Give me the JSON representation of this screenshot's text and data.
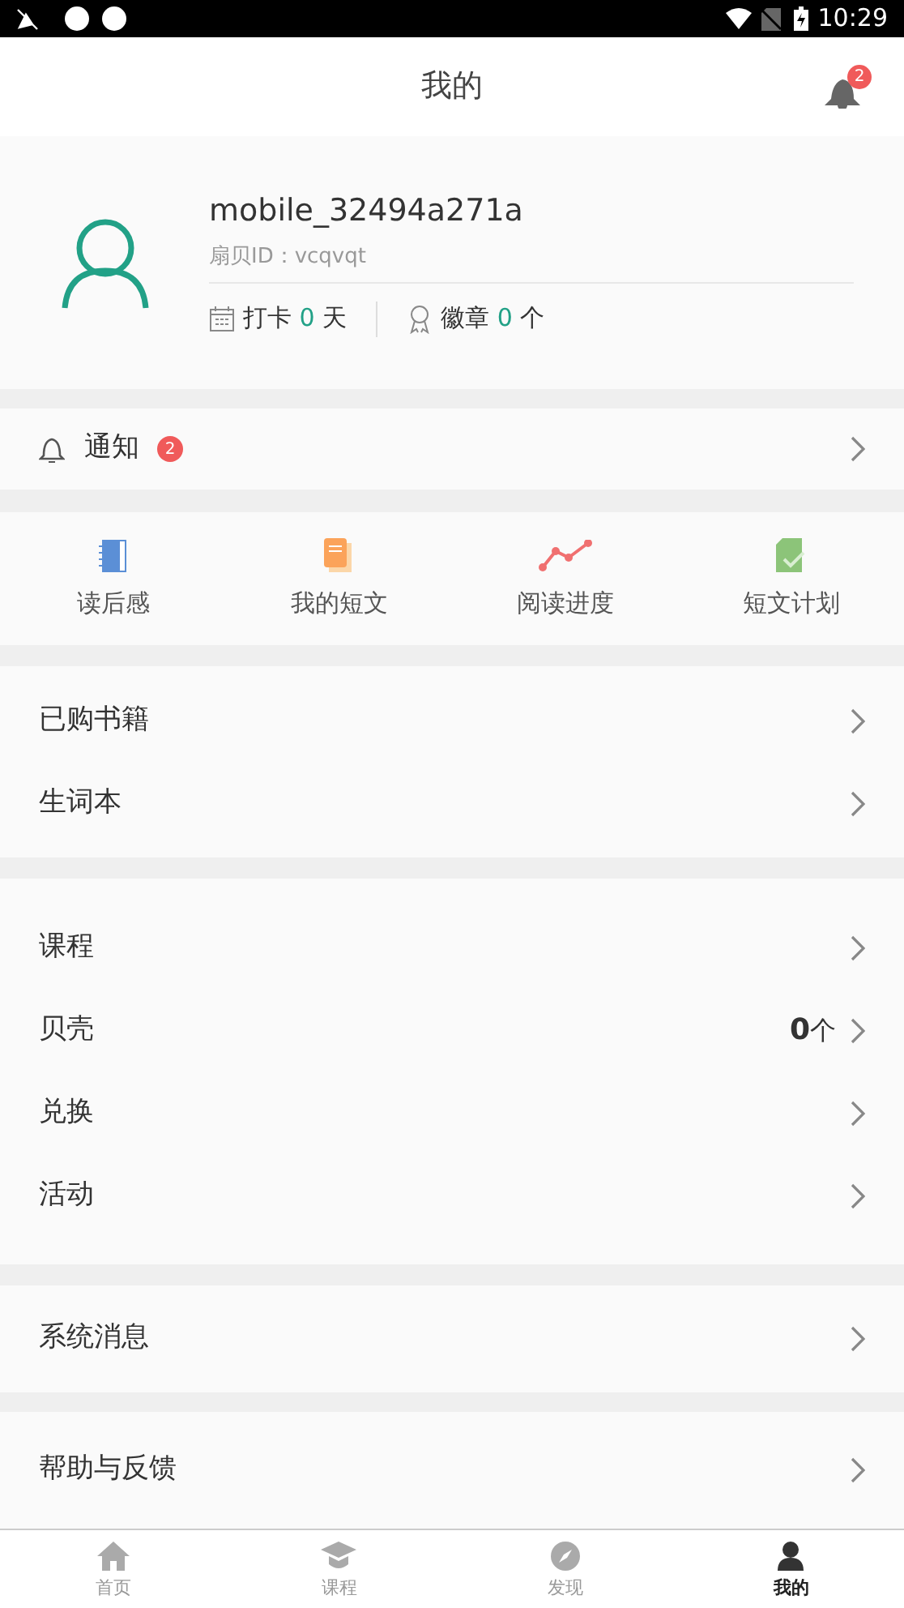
{
  "status_bar": {
    "time": "10:29"
  },
  "header": {
    "title": "我的",
    "bell_badge": "2"
  },
  "profile": {
    "username": "mobile_32494a271a",
    "id_text": "扇贝ID：vcqvqt",
    "stats": [
      {
        "label": "打卡",
        "value": "0",
        "unit": "天"
      },
      {
        "label": "徽章",
        "value": "0",
        "unit": "个"
      }
    ]
  },
  "notice": {
    "label": "通知",
    "badge": "2"
  },
  "shortcuts": [
    {
      "label": "读后感"
    },
    {
      "label": "我的短文"
    },
    {
      "label": "阅读进度"
    },
    {
      "label": "短文计划"
    }
  ],
  "groups": [
    {
      "rows": [
        {
          "label": "已购书籍"
        },
        {
          "label": "生词本"
        }
      ]
    },
    {
      "rows": [
        {
          "label": "课程"
        },
        {
          "label": "贝壳",
          "value": "**0**个"
        },
        {
          "label": "兑换"
        },
        {
          "label": "活动"
        }
      ]
    },
    {
      "rows": [
        {
          "label": "系统消息"
        }
      ]
    },
    {
      "rows": [
        {
          "label": "帮助与反馈"
        }
      ]
    }
  ],
  "tabs": [
    {
      "label": "首页",
      "selected": false
    },
    {
      "label": "课程",
      "selected": false
    },
    {
      "label": "发现",
      "selected": false
    },
    {
      "label": "我的",
      "selected": true
    }
  ]
}
